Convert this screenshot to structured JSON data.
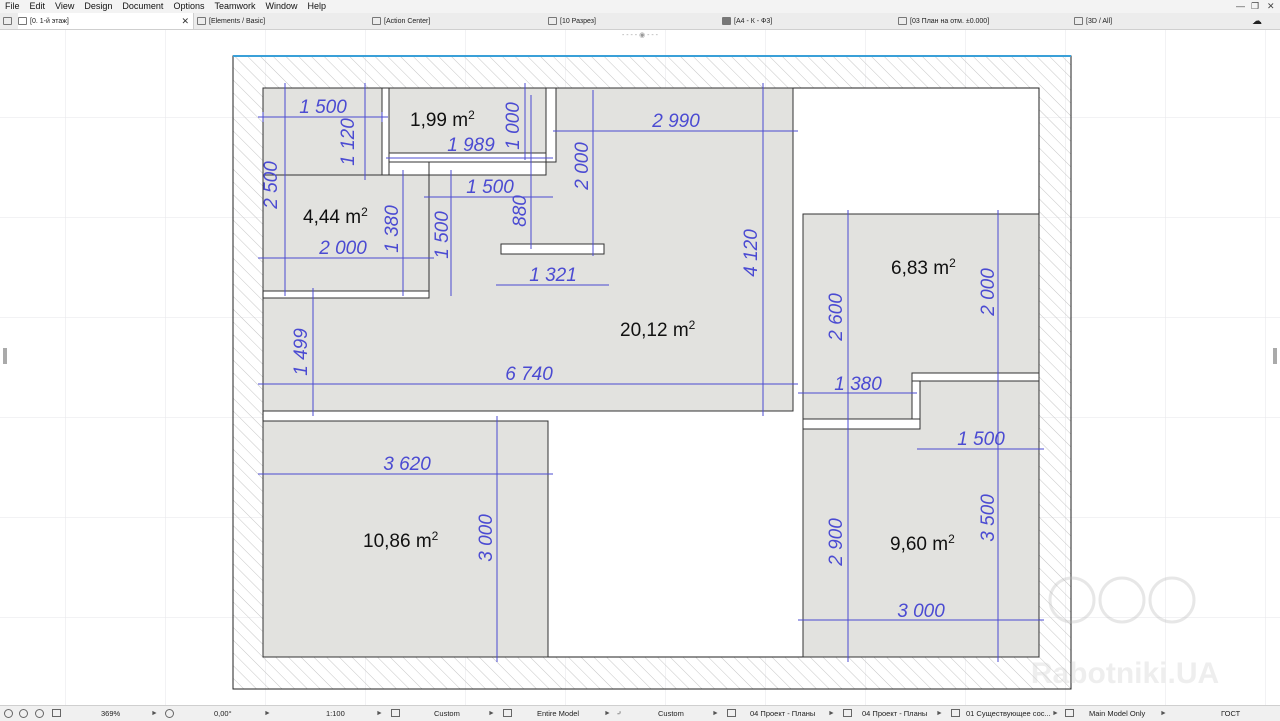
{
  "menu": [
    "File",
    "Edit",
    "View",
    "Design",
    "Document",
    "Options",
    "Teamwork",
    "Window",
    "Help"
  ],
  "tabs": [
    {
      "label": "[0. 1-й этаж]"
    },
    {
      "label": "[Elements / Basic]"
    },
    {
      "label": "[Action Center]"
    },
    {
      "label": "[10 Разрез]"
    },
    {
      "label": "[A4 - К - Ф3]"
    },
    {
      "label": "[03 План на отм. ±0.000]"
    },
    {
      "label": "[3D / All]"
    }
  ],
  "status": {
    "zoom": "369%",
    "angle": "0,00°",
    "scale": "1:100",
    "pen_set": "Custom",
    "model_view": "Entire Model",
    "filter": "Custom",
    "view_set": "04 Проект - Планы",
    "layer_set": "04 Проект - Планы",
    "renovation": "01 Существующее сос...",
    "structure": "Main Model Only",
    "standard": "ГОСТ"
  },
  "dimensions": [
    "1 500",
    "1 120",
    "1,99",
    "1 000",
    "2 990",
    "1 989",
    "2 500",
    "1 500",
    "2 000",
    "880",
    "1 380",
    "4 120",
    "1 500",
    "2 000",
    "6,83",
    "1 321",
    "2 000",
    "2 600",
    "1 499",
    "1 380",
    "6 740",
    "1 500",
    "3 620",
    "3 000",
    "3 500",
    "2 900",
    "3 000"
  ],
  "rooms": [
    {
      "value": "1,99",
      "unit": "m",
      "exp": "2"
    },
    {
      "value": "4,44",
      "unit": "m",
      "exp": "2"
    },
    {
      "value": "6,83",
      "unit": "m",
      "exp": "2"
    },
    {
      "value": "20,12",
      "unit": "m",
      "exp": "2"
    },
    {
      "value": "10,86",
      "unit": "m",
      "exp": "2"
    },
    {
      "value": "9,60",
      "unit": "m",
      "exp": "2"
    }
  ],
  "watermark": "Rabotniki.UA",
  "colors": {
    "dim": "#4b4bd2",
    "room_fill": "#e2e2df",
    "wall_hatch": "#c8c8c8",
    "grid": "#e6e6ea",
    "selection": "#3aa0d8"
  }
}
